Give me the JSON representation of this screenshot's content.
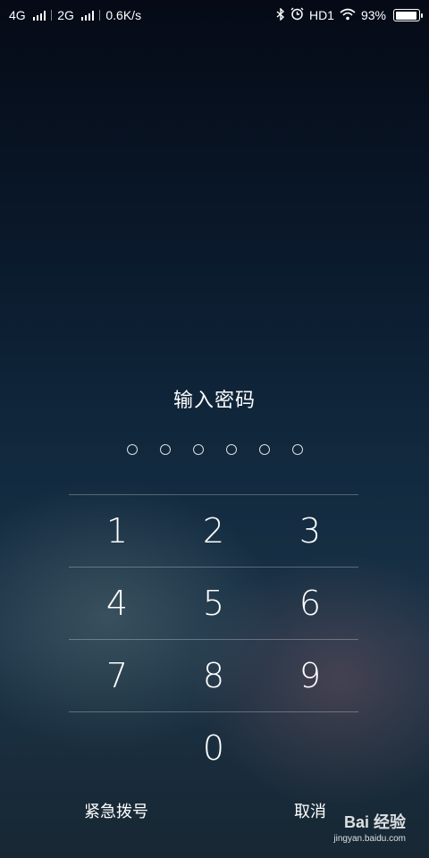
{
  "status_bar": {
    "network1": "4G",
    "network2": "2G",
    "speed": "0.6K/s",
    "hd": "HD1",
    "battery_percent": "93%",
    "battery_level": 0.93
  },
  "lock": {
    "prompt": "输入密码",
    "pin_length": 6
  },
  "keypad": {
    "keys": [
      "1",
      "2",
      "3",
      "4",
      "5",
      "6",
      "7",
      "8",
      "9",
      "0"
    ]
  },
  "actions": {
    "emergency": "紧急拨号",
    "cancel": "取消"
  },
  "watermark": {
    "brand": "Bai  经验",
    "url": "jingyan.baidu.com"
  }
}
